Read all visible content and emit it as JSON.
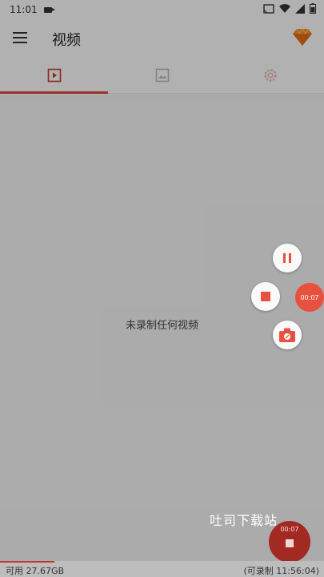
{
  "status": {
    "time": "11:01"
  },
  "appbar": {
    "title": "视频"
  },
  "tabs": [
    {
      "icon": "video-icon",
      "active": true
    },
    {
      "icon": "image-icon",
      "active": false
    },
    {
      "icon": "settings-icon",
      "active": false
    }
  ],
  "content": {
    "empty_text": "未录制任何视频"
  },
  "floating": {
    "timer": "00:07"
  },
  "record_fab": {
    "timer": "00:07"
  },
  "watermark": "吐司下载站",
  "footer": {
    "storage": "可用 27.67GB",
    "remaining": "(可录制 11:56:04)"
  },
  "colors": {
    "accent": "#d9463a",
    "fab_red": "#e8503f"
  }
}
